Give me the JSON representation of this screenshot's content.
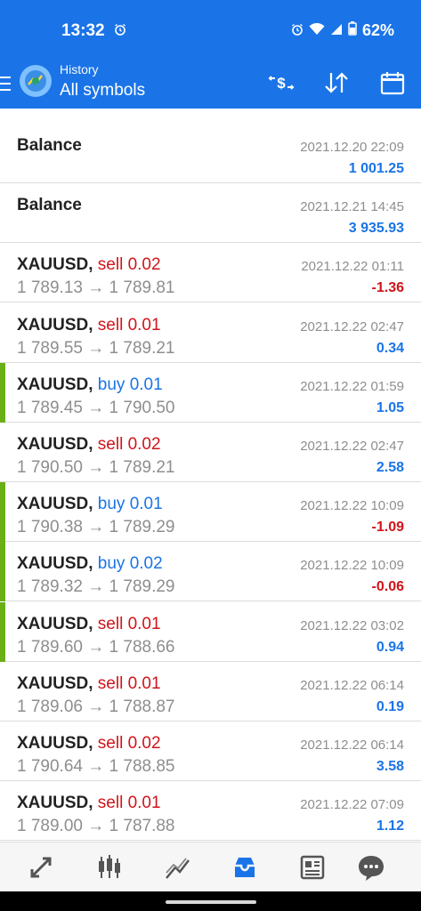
{
  "status_bar": {
    "time": "13:32",
    "battery": "62%"
  },
  "header": {
    "subtitle": "History",
    "title": "All symbols"
  },
  "rows": [
    {
      "kind": "balance",
      "symbol": "Balance",
      "time": "2021.12.20 22:09",
      "profit": "1 001.25",
      "negative": false,
      "accent": false
    },
    {
      "kind": "balance",
      "symbol": "Balance",
      "time": "2021.12.21 14:45",
      "profit": "3 935.93",
      "negative": false,
      "accent": false
    },
    {
      "kind": "trade",
      "symbol": "XAUUSD,",
      "type": "sell 0.02",
      "side": "sell",
      "open": "1 789.13",
      "close": "1 789.81",
      "time": "2021.12.22 01:11",
      "profit": "-1.36",
      "negative": true,
      "accent": false
    },
    {
      "kind": "trade",
      "symbol": "XAUUSD,",
      "type": "sell 0.01",
      "side": "sell",
      "open": "1 789.55",
      "close": "1 789.21",
      "time": "2021.12.22 02:47",
      "profit": "0.34",
      "negative": false,
      "accent": false
    },
    {
      "kind": "trade",
      "symbol": "XAUUSD,",
      "type": "buy 0.01",
      "side": "buy",
      "open": "1 789.45",
      "close": "1 790.50",
      "time": "2021.12.22 01:59",
      "profit": "1.05",
      "negative": false,
      "accent": true
    },
    {
      "kind": "trade",
      "symbol": "XAUUSD,",
      "type": "sell 0.02",
      "side": "sell",
      "open": "1 790.50",
      "close": "1 789.21",
      "time": "2021.12.22 02:47",
      "profit": "2.58",
      "negative": false,
      "accent": false
    },
    {
      "kind": "trade",
      "symbol": "XAUUSD,",
      "type": "buy 0.01",
      "side": "buy",
      "open": "1 790.38",
      "close": "1 789.29",
      "time": "2021.12.22 10:09",
      "profit": "-1.09",
      "negative": true,
      "accent": true
    },
    {
      "kind": "trade",
      "symbol": "XAUUSD,",
      "type": "buy 0.02",
      "side": "buy",
      "open": "1 789.32",
      "close": "1 789.29",
      "time": "2021.12.22 10:09",
      "profit": "-0.06",
      "negative": true,
      "accent": true
    },
    {
      "kind": "trade",
      "symbol": "XAUUSD,",
      "type": "sell 0.01",
      "side": "sell",
      "open": "1 789.60",
      "close": "1 788.66",
      "time": "2021.12.22 03:02",
      "profit": "0.94",
      "negative": false,
      "accent": true
    },
    {
      "kind": "trade",
      "symbol": "XAUUSD,",
      "type": "sell 0.01",
      "side": "sell",
      "open": "1 789.06",
      "close": "1 788.87",
      "time": "2021.12.22 06:14",
      "profit": "0.19",
      "negative": false,
      "accent": false
    },
    {
      "kind": "trade",
      "symbol": "XAUUSD,",
      "type": "sell 0.02",
      "side": "sell",
      "open": "1 790.64",
      "close": "1 788.85",
      "time": "2021.12.22 06:14",
      "profit": "3.58",
      "negative": false,
      "accent": false
    },
    {
      "kind": "trade",
      "symbol": "XAUUSD,",
      "type": "sell 0.01",
      "side": "sell",
      "open": "1 789.00",
      "close": "1 787.88",
      "time": "2021.12.22 07:09",
      "profit": "1.12",
      "negative": false,
      "accent": false
    }
  ],
  "arrow": "→",
  "icons": {
    "status": [
      "alarm-icon",
      "wifi-icon",
      "signal-icon",
      "battery-icon"
    ],
    "toolbar": [
      "deposit-filter-icon",
      "sort-icon",
      "calendar-icon"
    ],
    "nav": [
      "trade-icon",
      "chart-candles-icon",
      "chart-line-icon",
      "history-icon",
      "news-icon",
      "chat-icon"
    ]
  },
  "colors": {
    "accent": "#1a74e8",
    "sell": "#d0141a",
    "buy": "#1a74e8",
    "profit_negative": "#d0141a",
    "profit_positive": "#1a74e8",
    "row_marker": "#6aaf16"
  }
}
